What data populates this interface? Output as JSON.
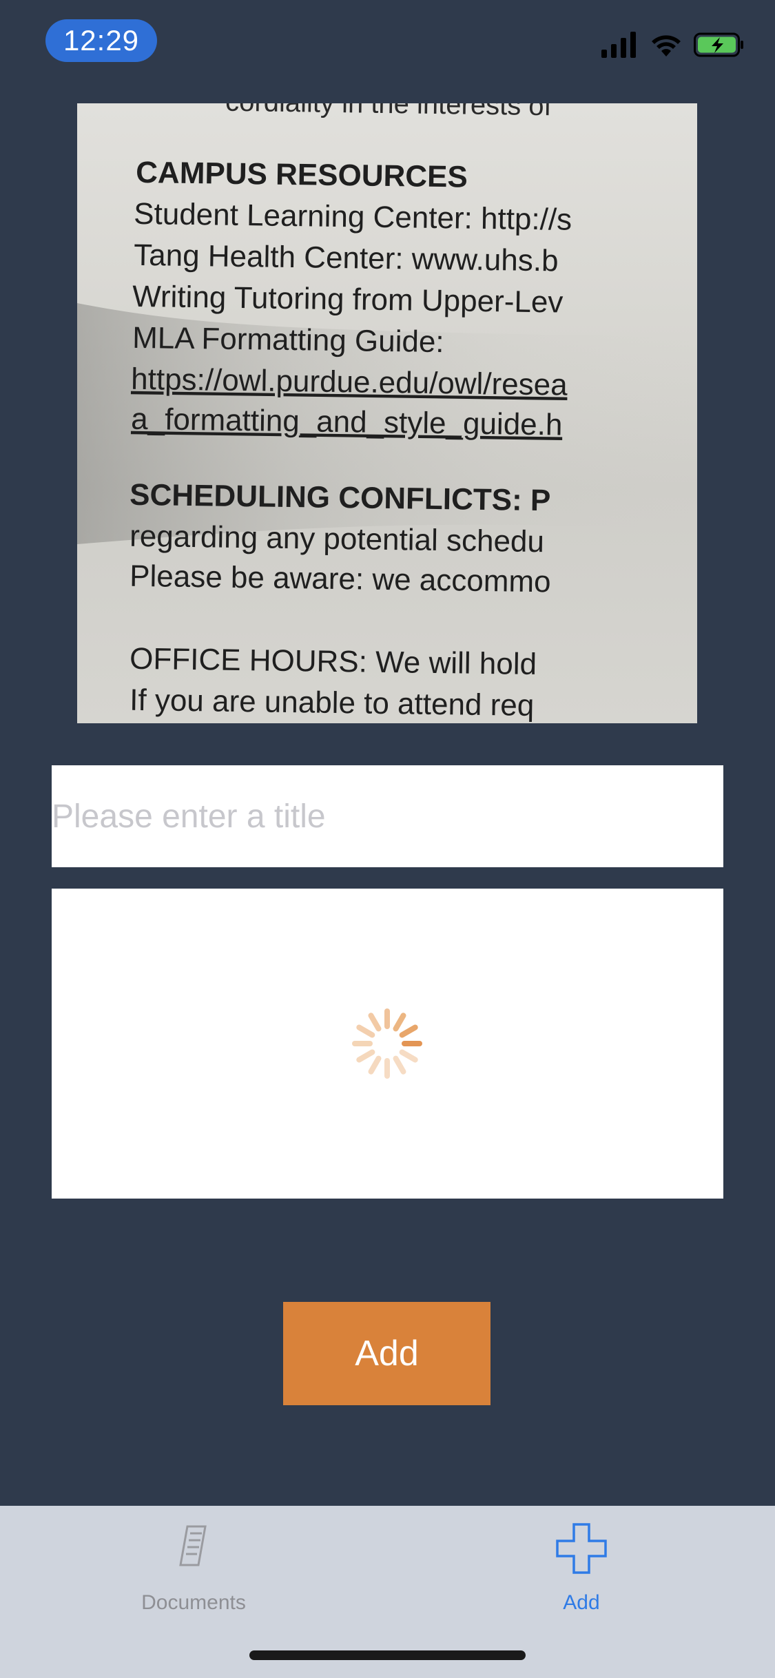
{
  "status_bar": {
    "time": "12:29",
    "icons": [
      "cellular-signal-icon",
      "wifi-icon",
      "battery-charging-icon"
    ]
  },
  "scanned_document": {
    "lines": [
      "cordiality in the interests of",
      "CAMPUS RESOURCES",
      "Student Learning Center: http://s",
      "Tang Health Center: www.uhs.b",
      "Writing Tutoring from Upper-Lev",
      "MLA Formatting Guide:",
      "https://owl.purdue.edu/owl/resea",
      "a_formatting_and_style_guide.h",
      "SCHEDULING CONFLICTS: P",
      "regarding any potential schedu",
      "Please be aware: we accommo",
      "OFFICE HOURS: We will hold",
      "If you are unable to attend req"
    ]
  },
  "form": {
    "title_placeholder": "Please enter a title",
    "title_value": "",
    "add_button_label": "Add"
  },
  "tab_bar": {
    "tabs": [
      {
        "label": "Documents",
        "icon": "document-scan-icon",
        "active": false
      },
      {
        "label": "Add",
        "icon": "plus-icon",
        "active": true
      }
    ]
  },
  "colors": {
    "background": "#2f3a4c",
    "accent_orange": "#d9823a",
    "active_tab_blue": "#2f7be6",
    "time_pill_blue": "#2f6fd6",
    "tab_bar_bg": "#cfd4dd"
  }
}
